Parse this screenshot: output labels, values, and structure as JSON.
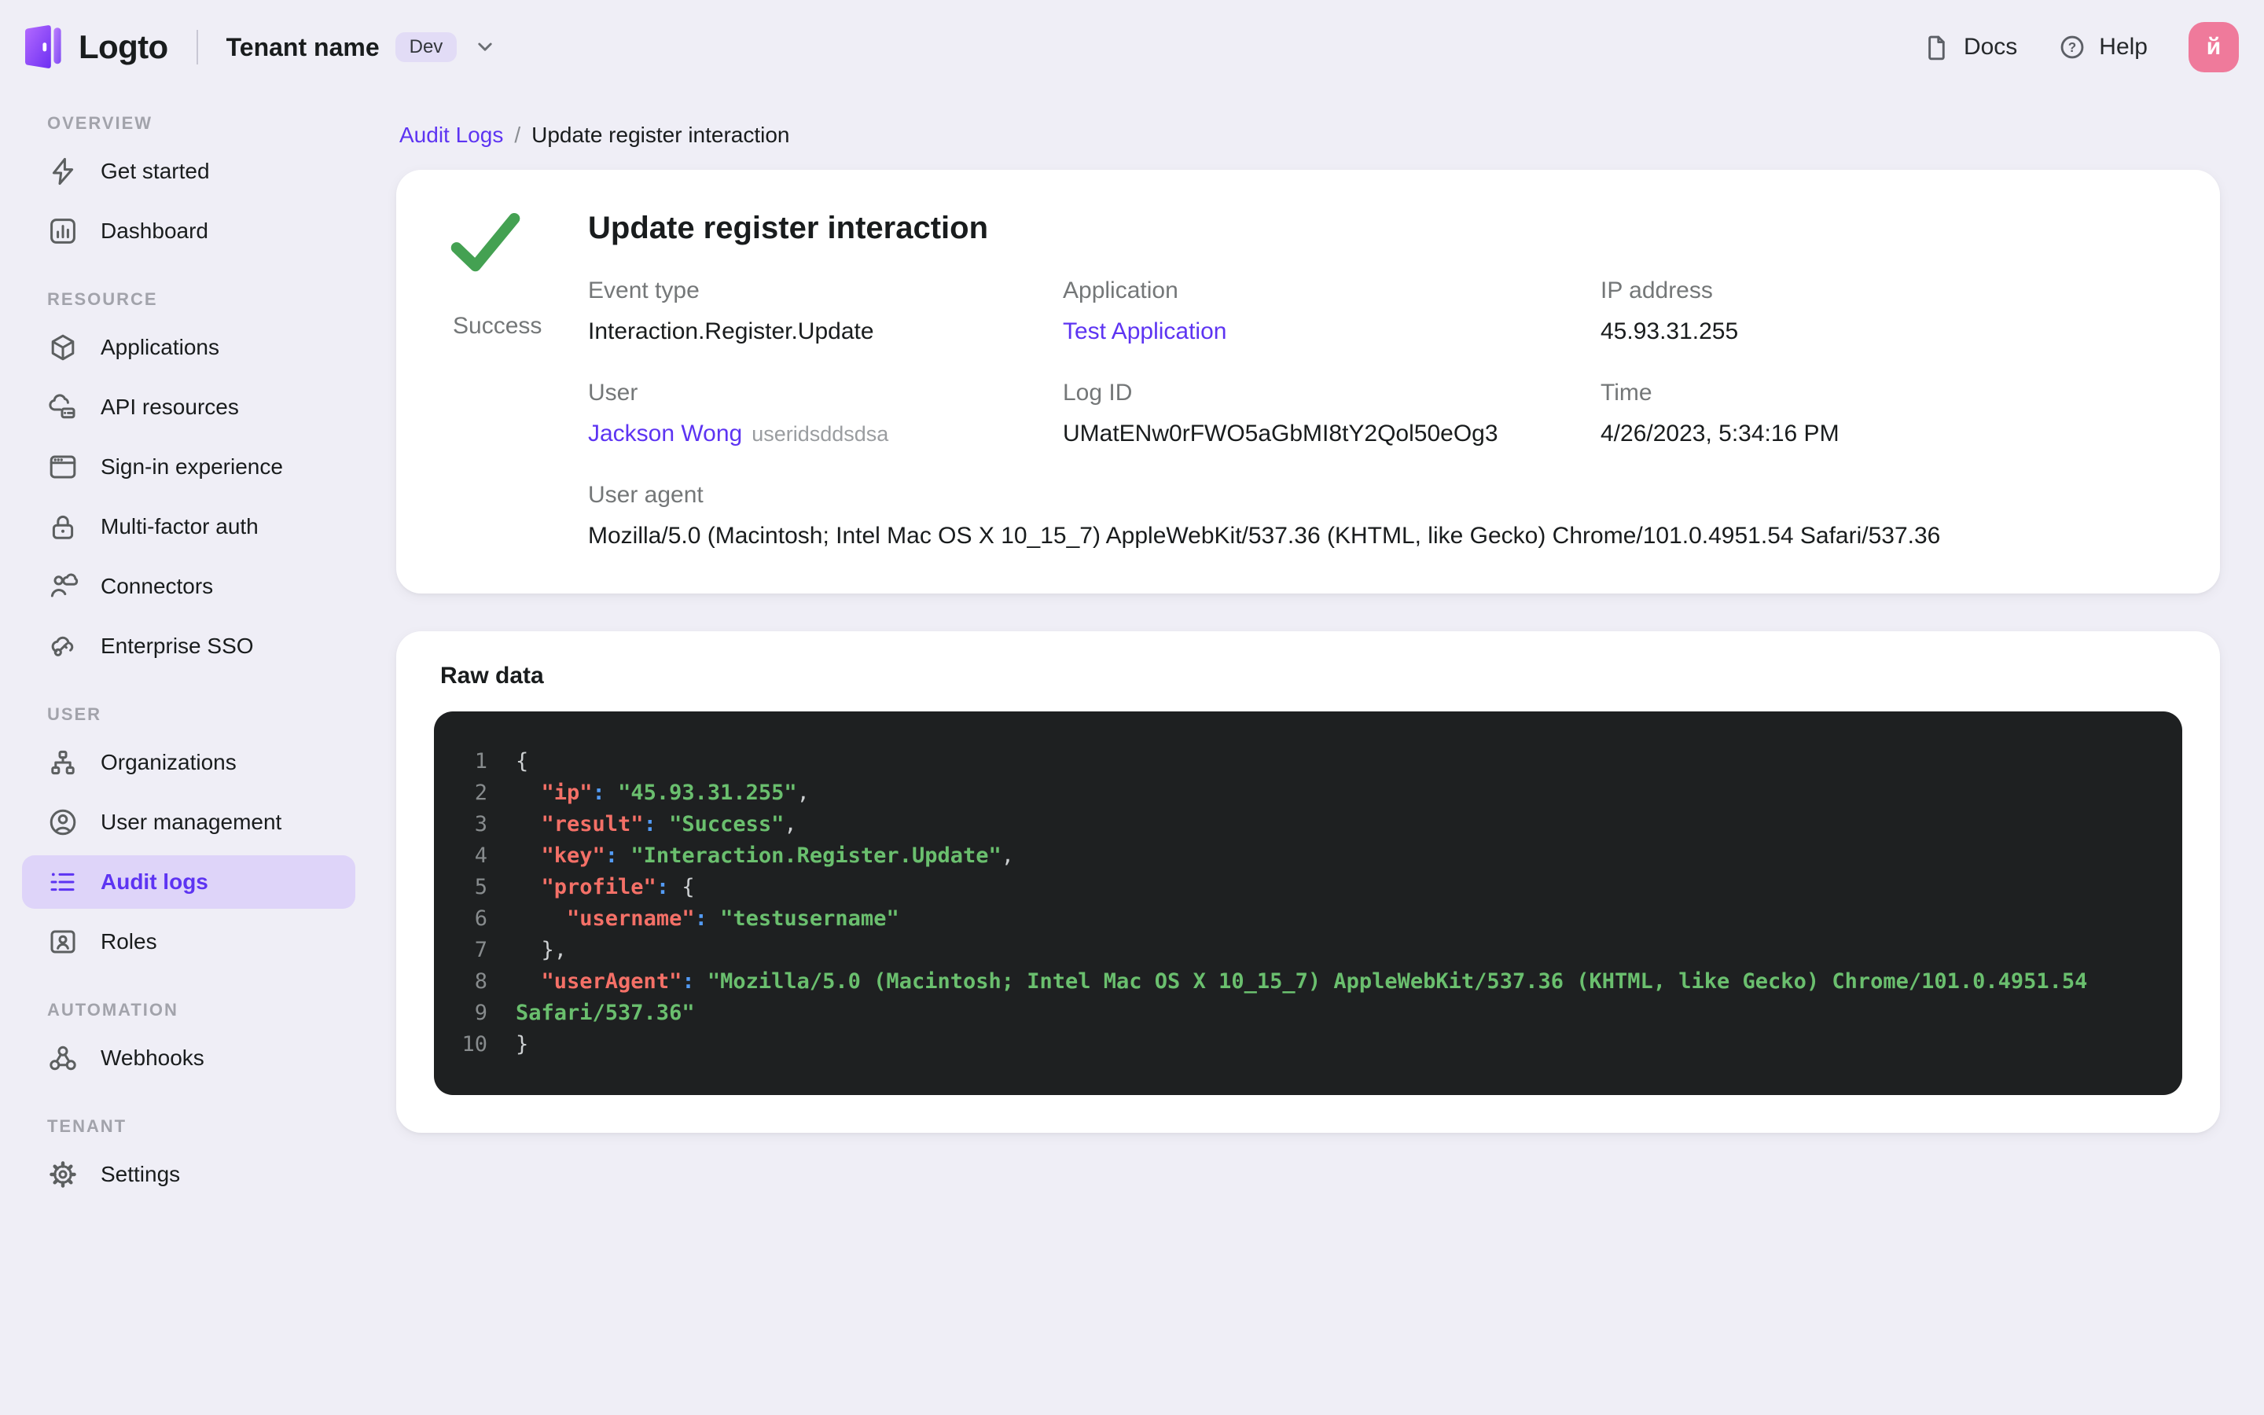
{
  "colors": {
    "page_bg": "#efeef6",
    "card_bg": "#ffffff",
    "accent": "#5d34f2",
    "accent_pill": "#ded4f9",
    "accent_soft": "#e2dcf6",
    "success": "#44a152",
    "avatar_bg": "#ef7a9b",
    "text_primary": "#191c1d",
    "text_secondary": "#747778",
    "code_bg": "#1e2021",
    "code_line_number": "#878b8d",
    "code_key": "#f47067",
    "code_colon": "#539bf5",
    "code_string": "#6abf6e",
    "code_punc": "#cdd0d2"
  },
  "topbar": {
    "brand": "Logto",
    "tenant_name": "Tenant name",
    "tenant_env_tag": "Dev",
    "docs_label": "Docs",
    "help_label": "Help",
    "avatar_initial": "й"
  },
  "sidebar": {
    "sections": [
      {
        "title": "OVERVIEW",
        "items": [
          {
            "label": "Get started",
            "icon": "lightning-icon"
          },
          {
            "label": "Dashboard",
            "icon": "bar-chart-icon"
          }
        ]
      },
      {
        "title": "RESOURCE",
        "items": [
          {
            "label": "Applications",
            "icon": "cube-icon"
          },
          {
            "label": "API resources",
            "icon": "cloud-server-icon"
          },
          {
            "label": "Sign-in experience",
            "icon": "browser-icon"
          },
          {
            "label": "Multi-factor auth",
            "icon": "lock-icon"
          },
          {
            "label": "Connectors",
            "icon": "connector-icon"
          },
          {
            "label": "Enterprise SSO",
            "icon": "cloud-key-icon"
          }
        ]
      },
      {
        "title": "USER",
        "items": [
          {
            "label": "Organizations",
            "icon": "org-tree-icon"
          },
          {
            "label": "User management",
            "icon": "user-circle-icon"
          },
          {
            "label": "Audit logs",
            "icon": "audit-list-icon",
            "active": true
          },
          {
            "label": "Roles",
            "icon": "id-card-icon"
          }
        ]
      },
      {
        "title": "AUTOMATION",
        "items": [
          {
            "label": "Webhooks",
            "icon": "webhook-icon"
          }
        ]
      },
      {
        "title": "TENANT",
        "items": [
          {
            "label": "Settings",
            "icon": "gear-icon"
          }
        ]
      }
    ]
  },
  "breadcrumb": {
    "parent": "Audit Logs",
    "separator": "/",
    "current": "Update register interaction"
  },
  "detail": {
    "title": "Update register interaction",
    "status": "Success",
    "fields": [
      {
        "label": "Event type",
        "value": "Interaction.Register.Update",
        "type": "text"
      },
      {
        "label": "Application",
        "value": "Test Application",
        "type": "link"
      },
      {
        "label": "IP address",
        "value": "45.93.31.255",
        "type": "text"
      },
      {
        "label": "User",
        "value": "Jackson Wong",
        "suffix": "useridsddsdsa",
        "type": "link"
      },
      {
        "label": "Log ID",
        "value": "UMatENw0rFWO5aGbMI8tY2Qol50eOg3",
        "type": "text"
      },
      {
        "label": "Time",
        "value": "4/26/2023, 5:34:16 PM",
        "type": "text"
      }
    ],
    "user_agent_label": "User agent",
    "user_agent_value": "Mozilla/5.0 (Macintosh; Intel Mac OS X 10_15_7) AppleWebKit/537.36 (KHTML, like Gecko) Chrome/101.0.4951.54 Safari/537.36"
  },
  "raw_data": {
    "title": "Raw data",
    "lines": [
      {
        "num": "1",
        "seg": [
          [
            "p",
            "{"
          ]
        ]
      },
      {
        "num": "2",
        "seg": [
          [
            "p",
            "  "
          ],
          [
            "k",
            "\"ip\""
          ],
          [
            "c",
            ":"
          ],
          [
            "p",
            " "
          ],
          [
            "s",
            "\"45.93.31.255\""
          ],
          [
            "p",
            ","
          ]
        ]
      },
      {
        "num": "3",
        "seg": [
          [
            "p",
            "  "
          ],
          [
            "k",
            "\"result\""
          ],
          [
            "c",
            ":"
          ],
          [
            "p",
            " "
          ],
          [
            "s",
            "\"Success\""
          ],
          [
            "p",
            ","
          ]
        ]
      },
      {
        "num": "4",
        "seg": [
          [
            "p",
            "  "
          ],
          [
            "k",
            "\"key\""
          ],
          [
            "c",
            ":"
          ],
          [
            "p",
            " "
          ],
          [
            "s",
            "\"Interaction.Register.Update\""
          ],
          [
            "p",
            ","
          ]
        ]
      },
      {
        "num": "5",
        "seg": [
          [
            "p",
            "  "
          ],
          [
            "k",
            "\"profile\""
          ],
          [
            "c",
            ":"
          ],
          [
            "p",
            " "
          ],
          [
            "p",
            "{"
          ]
        ]
      },
      {
        "num": "6",
        "seg": [
          [
            "p",
            "    "
          ],
          [
            "k",
            "\"username\""
          ],
          [
            "c",
            ":"
          ],
          [
            "p",
            " "
          ],
          [
            "s",
            "\"testusername\""
          ]
        ]
      },
      {
        "num": "7",
        "seg": [
          [
            "p",
            "  },"
          ]
        ]
      },
      {
        "num": "8",
        "seg": [
          [
            "p",
            "  "
          ],
          [
            "k",
            "\"userAgent\""
          ],
          [
            "c",
            ":"
          ],
          [
            "p",
            " "
          ],
          [
            "s",
            "\"Mozilla/5.0 (Macintosh; Intel Mac OS X 10_15_7) AppleWebKit/537.36 (KHTML, like Gecko) Chrome/101.0.4951.54"
          ]
        ]
      },
      {
        "num": "9",
        "seg": [
          [
            "s",
            "Safari/537.36\""
          ]
        ]
      },
      {
        "num": "10",
        "seg": [
          [
            "p",
            "}"
          ]
        ]
      }
    ]
  }
}
